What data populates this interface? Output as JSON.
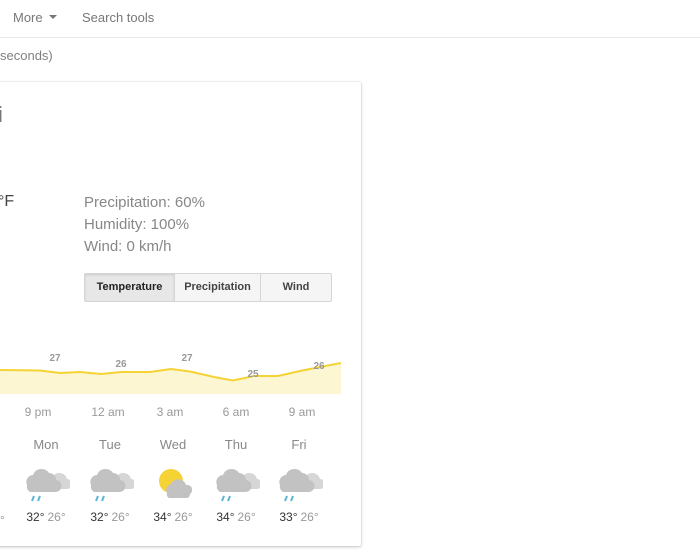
{
  "toolbar": {
    "more_label": "More",
    "search_tools_label": "Search tools"
  },
  "result_stats": "seconds)",
  "weather": {
    "location_fragment": "i",
    "unit_fragment": "°F",
    "precipitation": "Precipitation: 60%",
    "humidity": "Humidity: 100%",
    "wind": "Wind: 0 km/h",
    "tabs": [
      {
        "label": "Temperature",
        "active": true
      },
      {
        "label": "Precipitation",
        "active": false
      },
      {
        "label": "Wind",
        "active": false
      }
    ],
    "hourly_labels": [
      "27",
      "26",
      "27",
      "25",
      "26"
    ],
    "time_labels": [
      "9 pm",
      "12 am",
      "3 am",
      "6 am",
      "9 am"
    ],
    "days": [
      {
        "name": "Mon",
        "icon": "rain-cloud-icon",
        "high": "32°",
        "low": "26°"
      },
      {
        "name": "Tue",
        "icon": "rain-cloud-icon",
        "high": "32°",
        "low": "26°"
      },
      {
        "name": "Wed",
        "icon": "partly-cloudy-icon",
        "high": "34°",
        "low": "26°"
      },
      {
        "name": "Thu",
        "icon": "rain-cloud-icon",
        "high": "34°",
        "low": "26°"
      },
      {
        "name": "Fri",
        "icon": "rain-cloud-icon",
        "high": "33°",
        "low": "26°"
      }
    ],
    "clipped_day": {
      "icon": "rain-cloud-icon",
      "high_fragment": "°"
    },
    "accent_color": "#f5d334",
    "fill_color": "#fdf6d2",
    "rain_color": "#5ab6d3"
  }
}
